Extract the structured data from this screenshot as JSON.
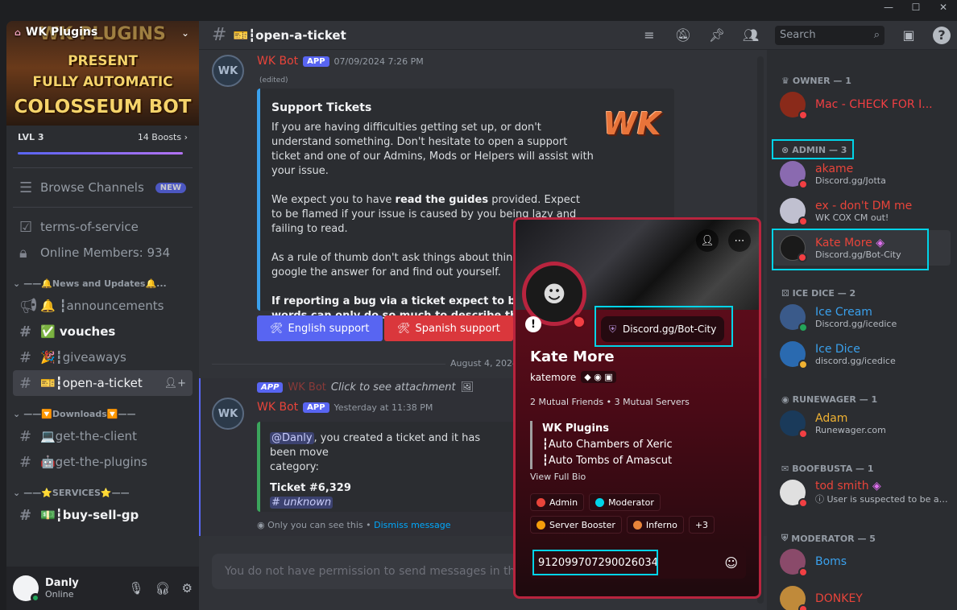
{
  "window": {
    "controls": [
      "—",
      "☐",
      "✕"
    ]
  },
  "server": {
    "name": "WK Plugins",
    "banner_lines": [
      "WK PLUGINS",
      "PRESENT",
      "FULLY AUTOMATIC",
      "COLOSSEUM BOT"
    ],
    "level": "LVL 3",
    "boosts": "14 Boosts",
    "boost_progress": 0.97
  },
  "sidebar": {
    "browse": "Browse Channels",
    "new_badge": "NEW",
    "top_channels": [
      "terms-of-service",
      "Online Members: 934"
    ],
    "categories": [
      {
        "label": "——🔔News and Updates🔔...",
        "channels": [
          {
            "label": "🔔 ┇announcements",
            "unread": false
          },
          {
            "label": "✅ vouches",
            "unread": true
          },
          {
            "label": "🎉┇giveaways",
            "unread": false
          },
          {
            "label": "🎫┇open-a-ticket",
            "unread": false,
            "active": true
          }
        ]
      },
      {
        "label": "——🔽Downloads🔽——",
        "channels": [
          {
            "label": "💻get-the-client"
          },
          {
            "label": "🤖get-the-plugins"
          }
        ]
      },
      {
        "label": "——⭐SERVICES⭐——",
        "channels": [
          {
            "label": "💵┇buy-sell-gp"
          }
        ]
      }
    ]
  },
  "user": {
    "name": "Danly",
    "status": "Online"
  },
  "header": {
    "channel": "🎫┇open-a-ticket",
    "search_placeholder": "Search"
  },
  "messages": {
    "m1": {
      "author": "WK Bot",
      "tag": "APP",
      "time": "07/09/2024 7:26 PM",
      "edited": "(edited)",
      "embed_title": "Support Tickets",
      "p1": "If you are having difficulties getting set up, or don't understand something. Don't hesitate to open a support ticket and one of our Admins, Mods or Helpers will assist with your issue.",
      "p2a": "We expect you to have ",
      "p2b": "read the guides",
      "p2c": " provided. Expect to be flamed if your issue is caused by you being lazy and failing to read.",
      "p3": "As a rule of thumb don't ask things about things tha easily google the answer for and find out yourself.",
      "p4": "If reporting a bug via a ticket expect to be asked f words can only do so much to describe the issue.",
      "logo": "WK",
      "btn1": "English support",
      "btn2": "Spanish support"
    },
    "date": "August 4, 2024",
    "m2": {
      "reply_tag": "APP",
      "reply_author": "WK Bot",
      "reply_text": "Click to see attachment",
      "author": "WK Bot",
      "tag": "APP",
      "time": "Yesterday at 11:38 PM",
      "mention": "@Danly",
      "text": ", you created a ticket and it has been move",
      "text2": "category:",
      "ticket": "Ticket #6,329",
      "unknown": "# unknown",
      "only_you": "Only you can see this • ",
      "dismiss": "Dismiss message"
    },
    "input_placeholder": "You do not have permission to send messages in this"
  },
  "members": {
    "groups": [
      {
        "label": "OWNER — 1"
      },
      {
        "label": "ADMIN — 3"
      },
      {
        "label": "ICE DICE — 2"
      },
      {
        "label": "RUNEWAGER — 1"
      },
      {
        "label": "BOOFBUSTA — 1"
      },
      {
        "label": "MODERATOR — 5"
      }
    ],
    "list": [
      {
        "name": "Mac - CHECK FOR I...",
        "sub": "",
        "color": "#f23f43"
      },
      {
        "name": "akame",
        "sub": "Discord.gg/Jotta",
        "color": "#e8443a"
      },
      {
        "name": "ex - don't DM me",
        "sub": "WK COX CM out!",
        "color": "#e8443a"
      },
      {
        "name": "Kate More",
        "sub": "Discord.gg/Bot-City",
        "color": "#e8443a"
      },
      {
        "name": "Ice Cream",
        "sub": "Discord.gg/icedice",
        "color": "#3aa1ed"
      },
      {
        "name": "Ice Dice",
        "sub": "discord.gg/icedice",
        "color": "#3aa1ed"
      },
      {
        "name": "Adam",
        "sub": "Runewager.com",
        "color": "#f0b232"
      },
      {
        "name": "tod smith",
        "sub": "ⓘ User is suspected to be a p...",
        "color": "#e8443a"
      },
      {
        "name": "Boms",
        "sub": "",
        "color": "#3aa1ed"
      },
      {
        "name": "DONKEY",
        "sub": "",
        "color": "#e8443a"
      }
    ]
  },
  "profile": {
    "name": "Kate More",
    "username": "katemore",
    "status": "Discord.gg/Bot-City",
    "mutual": "2 Mutual Friends • 3 Mutual Servers",
    "bio_title": "WK Plugins",
    "bio1": "┇Auto Chambers of Xeric",
    "bio2": "┇Auto Tombs of Amascut",
    "view_bio": "View Full Bio",
    "roles": [
      {
        "label": "Admin",
        "color": "#e8443a"
      },
      {
        "label": "Moderator",
        "color": "#00d4e8"
      },
      {
        "label": "Server Booster",
        "color": "#f59e0b"
      },
      {
        "label": "Inferno",
        "color": "#e8843a"
      }
    ],
    "more_roles": "+3",
    "message_value": "912099707290026034"
  }
}
